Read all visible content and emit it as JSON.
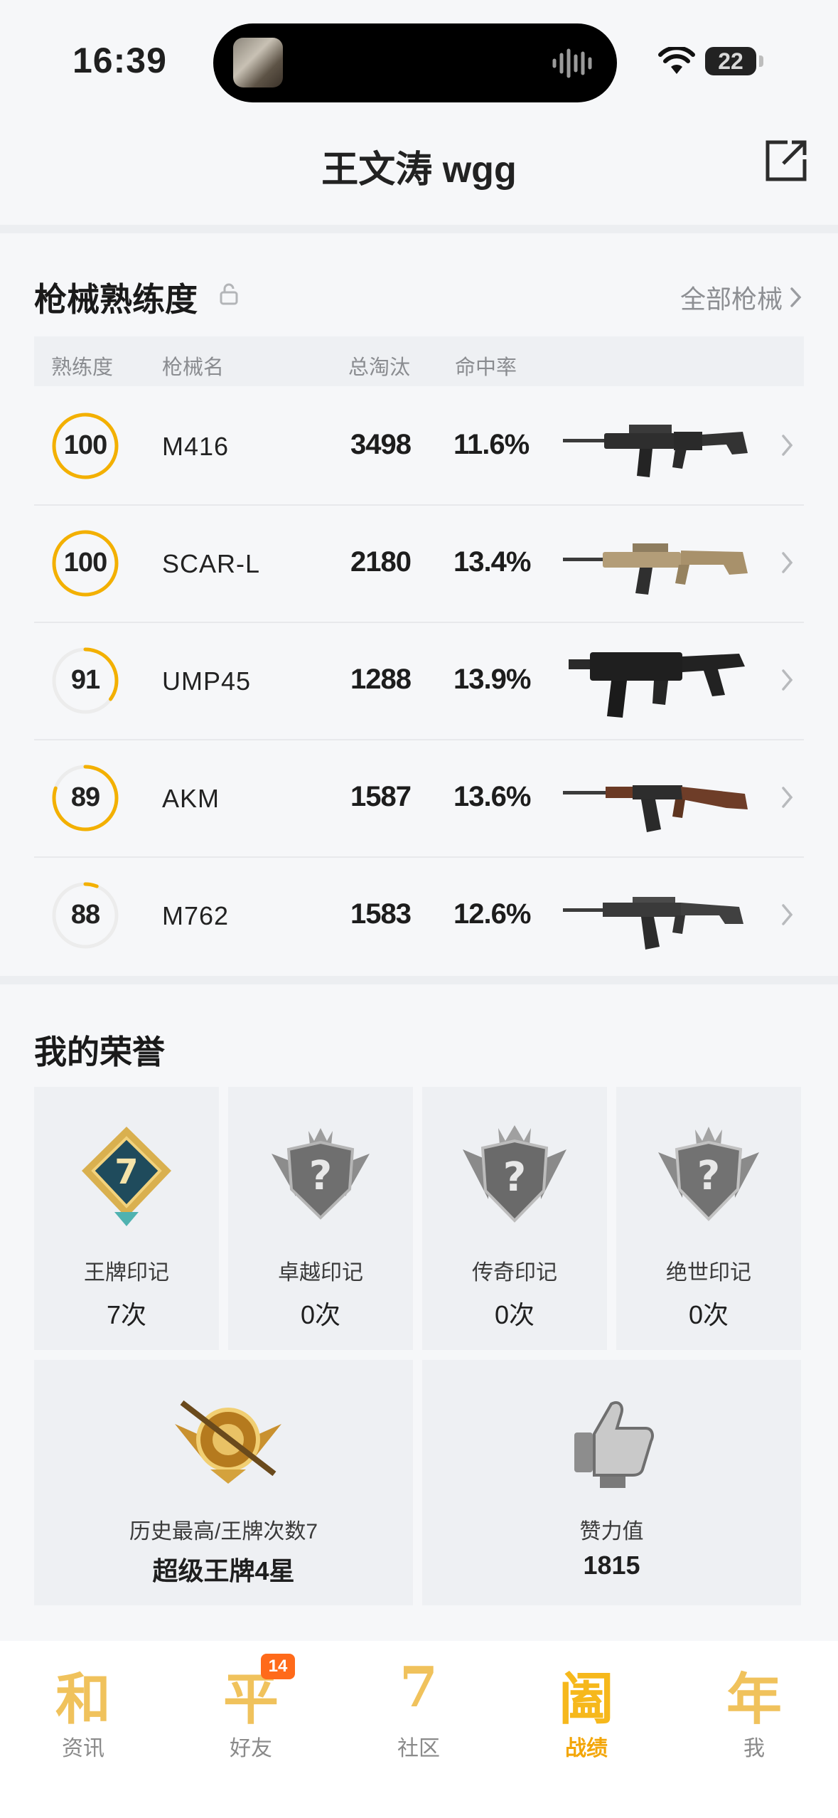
{
  "status": {
    "time": "16:39",
    "battery": "22"
  },
  "header": {
    "title": "王文涛 wgg"
  },
  "weapons": {
    "title": "枪械熟练度",
    "all_link": "全部枪械",
    "columns": [
      "熟练度",
      "枪械名",
      "总淘汰",
      "命中率"
    ],
    "rows": [
      {
        "proficiency": "100",
        "progress": 1.0,
        "name": "M416",
        "kills": "3498",
        "accuracy": "11.6%"
      },
      {
        "proficiency": "100",
        "progress": 1.0,
        "name": "SCAR-L",
        "kills": "2180",
        "accuracy": "13.4%"
      },
      {
        "proficiency": "91",
        "progress": 0.35,
        "name": "UMP45",
        "kills": "1288",
        "accuracy": "13.9%"
      },
      {
        "proficiency": "89",
        "progress": 0.8,
        "name": "AKM",
        "kills": "1587",
        "accuracy": "13.6%"
      },
      {
        "proficiency": "88",
        "progress": 0.06,
        "name": "M762",
        "kills": "1583",
        "accuracy": "12.6%"
      }
    ]
  },
  "honor": {
    "title": "我的荣誉",
    "marks": [
      {
        "label": "王牌印记",
        "value": "7次",
        "badge": "7"
      },
      {
        "label": "卓越印记",
        "value": "0次",
        "badge": "?"
      },
      {
        "label": "传奇印记",
        "value": "0次",
        "badge": "?"
      },
      {
        "label": "绝世印记",
        "value": "0次",
        "badge": "?"
      }
    ],
    "best": {
      "label": "历史最高/王牌次数7",
      "value": "超级王牌4星"
    },
    "likes": {
      "label": "赞力值",
      "value": "1815"
    }
  },
  "tabs": [
    {
      "glyph": "和",
      "label": "资讯"
    },
    {
      "glyph": "平",
      "label": "好友",
      "badge": "14"
    },
    {
      "glyph": "7",
      "label": "社区"
    },
    {
      "glyph": "阖",
      "label": "战绩",
      "active": true
    },
    {
      "glyph": "年",
      "label": "我"
    }
  ],
  "colors": {
    "accent": "#f3b000",
    "ring_track": "#ececec"
  }
}
